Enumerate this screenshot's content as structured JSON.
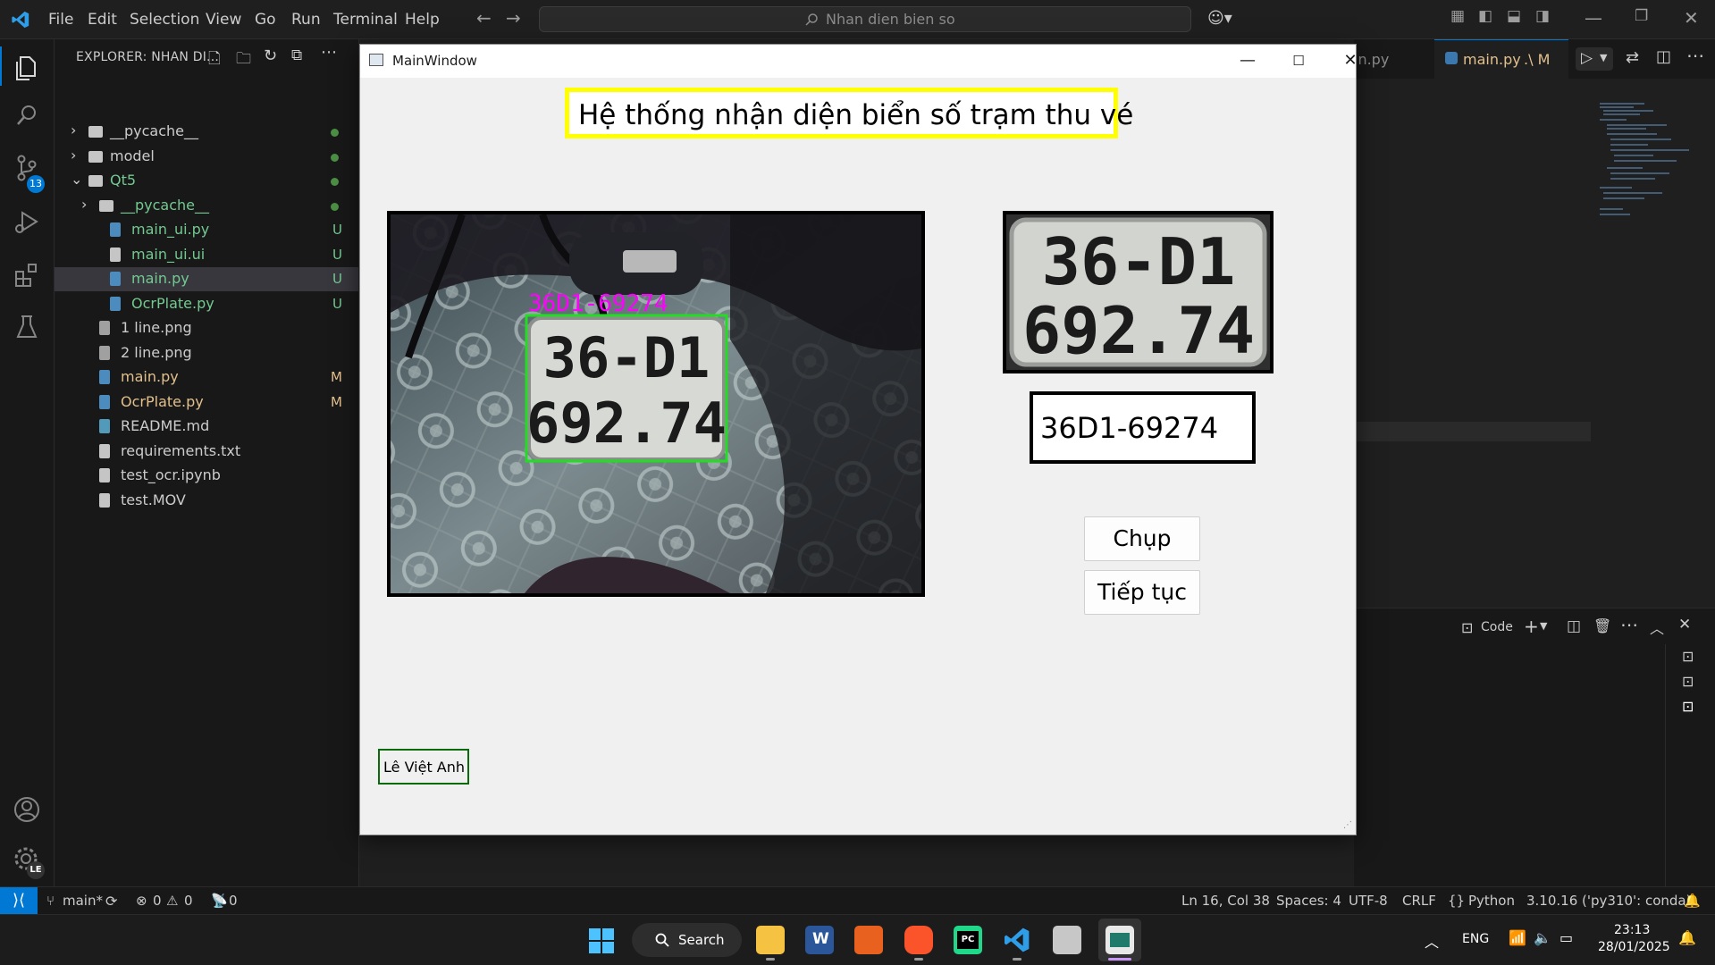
{
  "vscode": {
    "menu": [
      "File",
      "Edit",
      "Selection",
      "View",
      "Go",
      "Run",
      "Terminal",
      "Help"
    ],
    "command_center": "Nhan dien bien so",
    "source_control_badge": "13",
    "account_badge": "LE",
    "explorer_title": "EXPLORER: NHAN DI...",
    "tree": [
      {
        "name": "__pycache__",
        "type": "folder",
        "status": "dot",
        "color": "#cccccc"
      },
      {
        "name": "model",
        "type": "folder",
        "status": "dot",
        "color": "#cccccc"
      },
      {
        "name": "Qt5",
        "type": "folder-open",
        "status": "dot",
        "color": "#73c991"
      },
      {
        "name": "__pycache__",
        "type": "folder",
        "status": "dot",
        "color": "#73c991"
      },
      {
        "name": "main_ui.py",
        "type": "python",
        "status": "U",
        "color": "#73c991"
      },
      {
        "name": "main_ui.ui",
        "type": "file",
        "status": "U",
        "color": "#73c991"
      },
      {
        "name": "main.py",
        "type": "python",
        "status": "U",
        "color": "#73c991"
      },
      {
        "name": "OcrPlate.py",
        "type": "python",
        "status": "U",
        "color": "#73c991"
      },
      {
        "name": "1 line.png",
        "type": "image",
        "status": "",
        "color": "#cccccc"
      },
      {
        "name": "2 line.png",
        "type": "image",
        "status": "",
        "color": "#cccccc"
      },
      {
        "name": "main.py",
        "type": "python",
        "status": "M",
        "color": "#e2c08d"
      },
      {
        "name": "OcrPlate.py",
        "type": "python",
        "status": "M",
        "color": "#e2c08d"
      },
      {
        "name": "README.md",
        "type": "markdown",
        "status": "",
        "color": "#cccccc"
      },
      {
        "name": "requirements.txt",
        "type": "file",
        "status": "",
        "color": "#cccccc"
      },
      {
        "name": "test_ocr.ipynb",
        "type": "file",
        "status": "",
        "color": "#cccccc"
      },
      {
        "name": "test.MOV",
        "type": "file",
        "status": "",
        "color": "#cccccc"
      }
    ],
    "tabs": {
      "partial": "in.py",
      "active": "main.py",
      "active_path": ".\\ M"
    },
    "panel_label": "Code",
    "status": {
      "branch": "main*",
      "errors": "0",
      "warnings": "0",
      "ports": "0",
      "cursor": "Ln 16, Col 38",
      "spaces": "Spaces: 4",
      "encoding": "UTF-8",
      "eol": "CRLF",
      "language": "Python",
      "interpreter": "3.10.16 ('py310': conda)"
    }
  },
  "qt_window": {
    "title": "MainWindow",
    "heading": "Hệ thống nhận diện biển số trạm thu vé",
    "detected_label": "36D1-69274",
    "plate_line1": "36-D1",
    "plate_line2": "692.74",
    "result_text": "36D1-69274",
    "capture_button": "Chụp",
    "continue_button": "Tiếp tục",
    "author": "Lê Việt Anh"
  },
  "taskbar": {
    "search": "Search",
    "lang": "ENG",
    "time": "23:13",
    "date": "28/01/2025"
  },
  "colors": {
    "accent": "#0078d4",
    "heading_border": "#ffff00",
    "detection_box": "#22dd22",
    "detection_label": "#ff00ff",
    "untracked": "#73c991",
    "modified": "#e2c08d"
  }
}
